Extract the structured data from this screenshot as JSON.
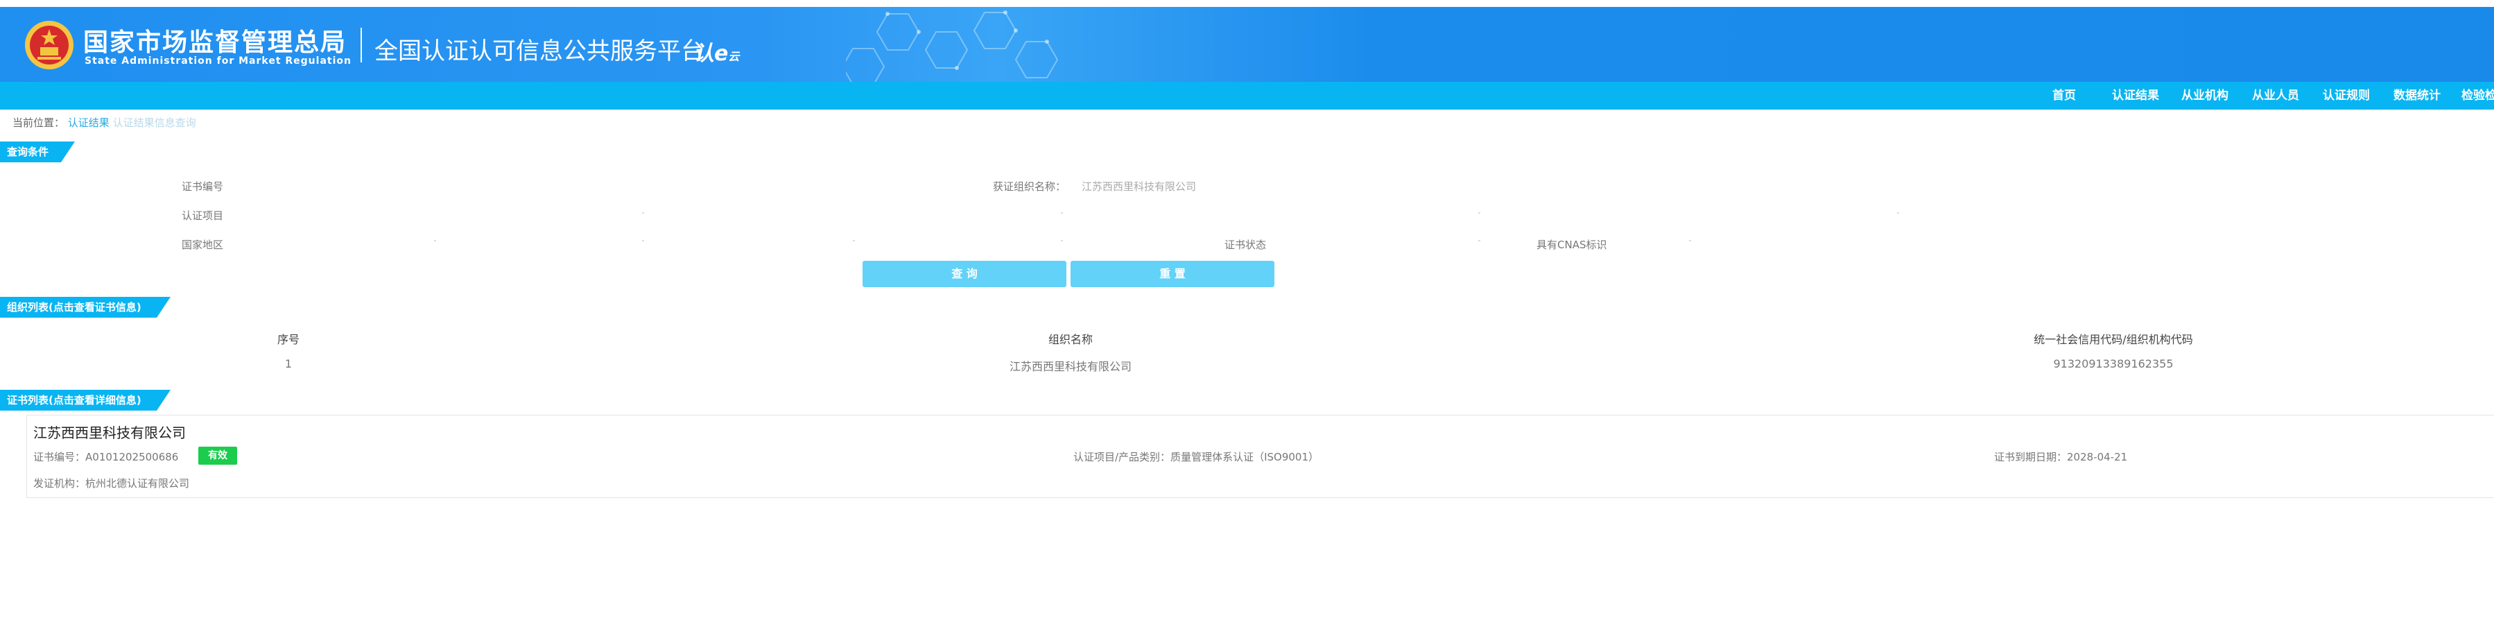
{
  "top_notice": "",
  "header": {
    "agency_cn": "国家市场监督管理总局",
    "agency_en": "State Administration  for  Market Regulation",
    "platform_title": "全国认证认可信息公共服务平台",
    "logo_text": "认e",
    "logo_small": "云"
  },
  "nav": {
    "items": [
      {
        "label": "首页"
      },
      {
        "label": "认证结果"
      },
      {
        "label": "从业机构"
      },
      {
        "label": "从业人员"
      },
      {
        "label": "认证规则"
      },
      {
        "label": "数据统计"
      },
      {
        "label": "检验检"
      }
    ]
  },
  "breadcrumb": {
    "prefix": "当前位置：",
    "link": "认证结果",
    "current": "认证结果信息查询"
  },
  "query": {
    "section_title": "查询条件",
    "cert_no_label": "证书编号",
    "org_name_label": "获证组织名称：",
    "org_name_value": "江苏西西里科技有限公司",
    "cert_project_label": "认证项目",
    "region_label": "国家地区",
    "cert_status_label": "证书状态",
    "cnas_label": "具有CNAS标识",
    "search_button": "查 询",
    "reset_button": "重 置"
  },
  "org_list": {
    "section_title": "组织列表(点击查看证书信息)",
    "columns": [
      "序号",
      "组织名称",
      "统一社会信用代码/组织机构代码"
    ],
    "rows": [
      [
        "1",
        "江苏西西里科技有限公司",
        "91320913389162355"
      ]
    ]
  },
  "cert_list": {
    "section_title": "证书列表(点击查看详细信息)",
    "cards": [
      {
        "org_name": "江苏西西里科技有限公司",
        "cert_no_label": "证书编号：",
        "cert_no": "A0101202500686",
        "status": "有效",
        "project_label": "认证项目/产品类别：",
        "project": "质量管理体系认证（ISO9001）",
        "expiry_label": "证书到期日期：",
        "expiry": "2028-04-21",
        "issuer_label": "发证机构：",
        "issuer": "杭州北德认证有限公司"
      }
    ]
  },
  "colors": {
    "header_blue": "#1f8ff0",
    "nav_cyan": "#09b4f2",
    "button": "#62d2f8",
    "valid_badge": "#1ccc4c"
  },
  "icons": [
    "national-emblem-icon",
    "hexagon-decoration"
  ]
}
